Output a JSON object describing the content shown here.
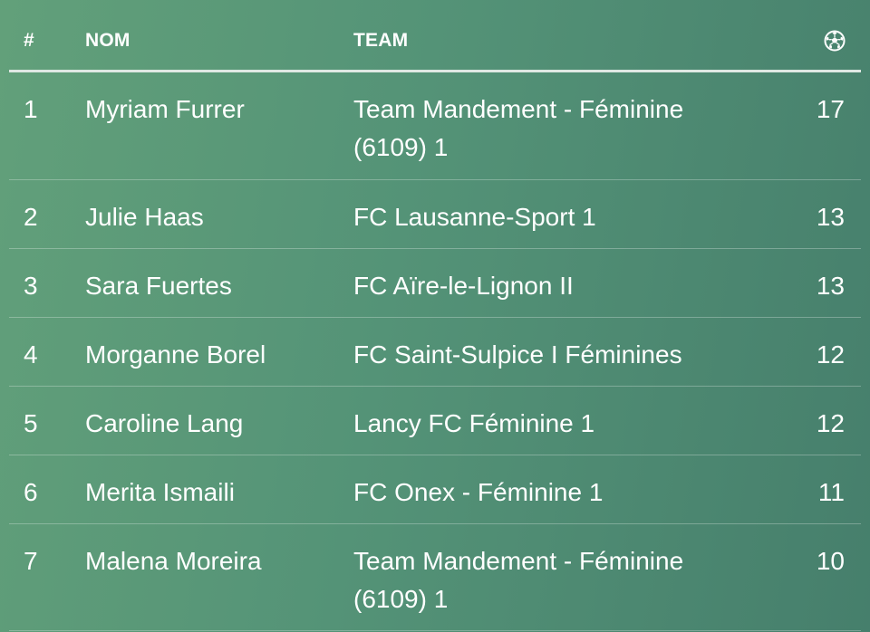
{
  "table": {
    "headers": {
      "rank": "#",
      "name": "NOM",
      "team": "TEAM",
      "goals_icon": "soccer-ball-icon"
    },
    "rows": [
      {
        "rank": "1",
        "name": "Myriam Furrer",
        "team": "Team Mandement - Féminine (6109) 1",
        "goals": "17"
      },
      {
        "rank": "2",
        "name": "Julie Haas",
        "team": "FC Lausanne-Sport 1",
        "goals": "13"
      },
      {
        "rank": "3",
        "name": "Sara Fuertes",
        "team": "FC Aïre-le-Lignon II",
        "goals": "13"
      },
      {
        "rank": "4",
        "name": "Morganne Borel",
        "team": "FC Saint-Sulpice I Féminines",
        "goals": "12"
      },
      {
        "rank": "5",
        "name": "Caroline Lang",
        "team": "Lancy FC Féminine 1",
        "goals": "12"
      },
      {
        "rank": "6",
        "name": "Merita Ismaili",
        "team": "FC Onex - Féminine 1",
        "goals": "11"
      },
      {
        "rank": "7",
        "name": "Malena Moreira",
        "team": "Team Mandement - Féminine (6109) 1",
        "goals": "10"
      }
    ]
  },
  "colors": {
    "background_start": "#62a07a",
    "background_end": "#467f6c",
    "text": "#ffffff",
    "header_rule": "#dfe8e3"
  }
}
